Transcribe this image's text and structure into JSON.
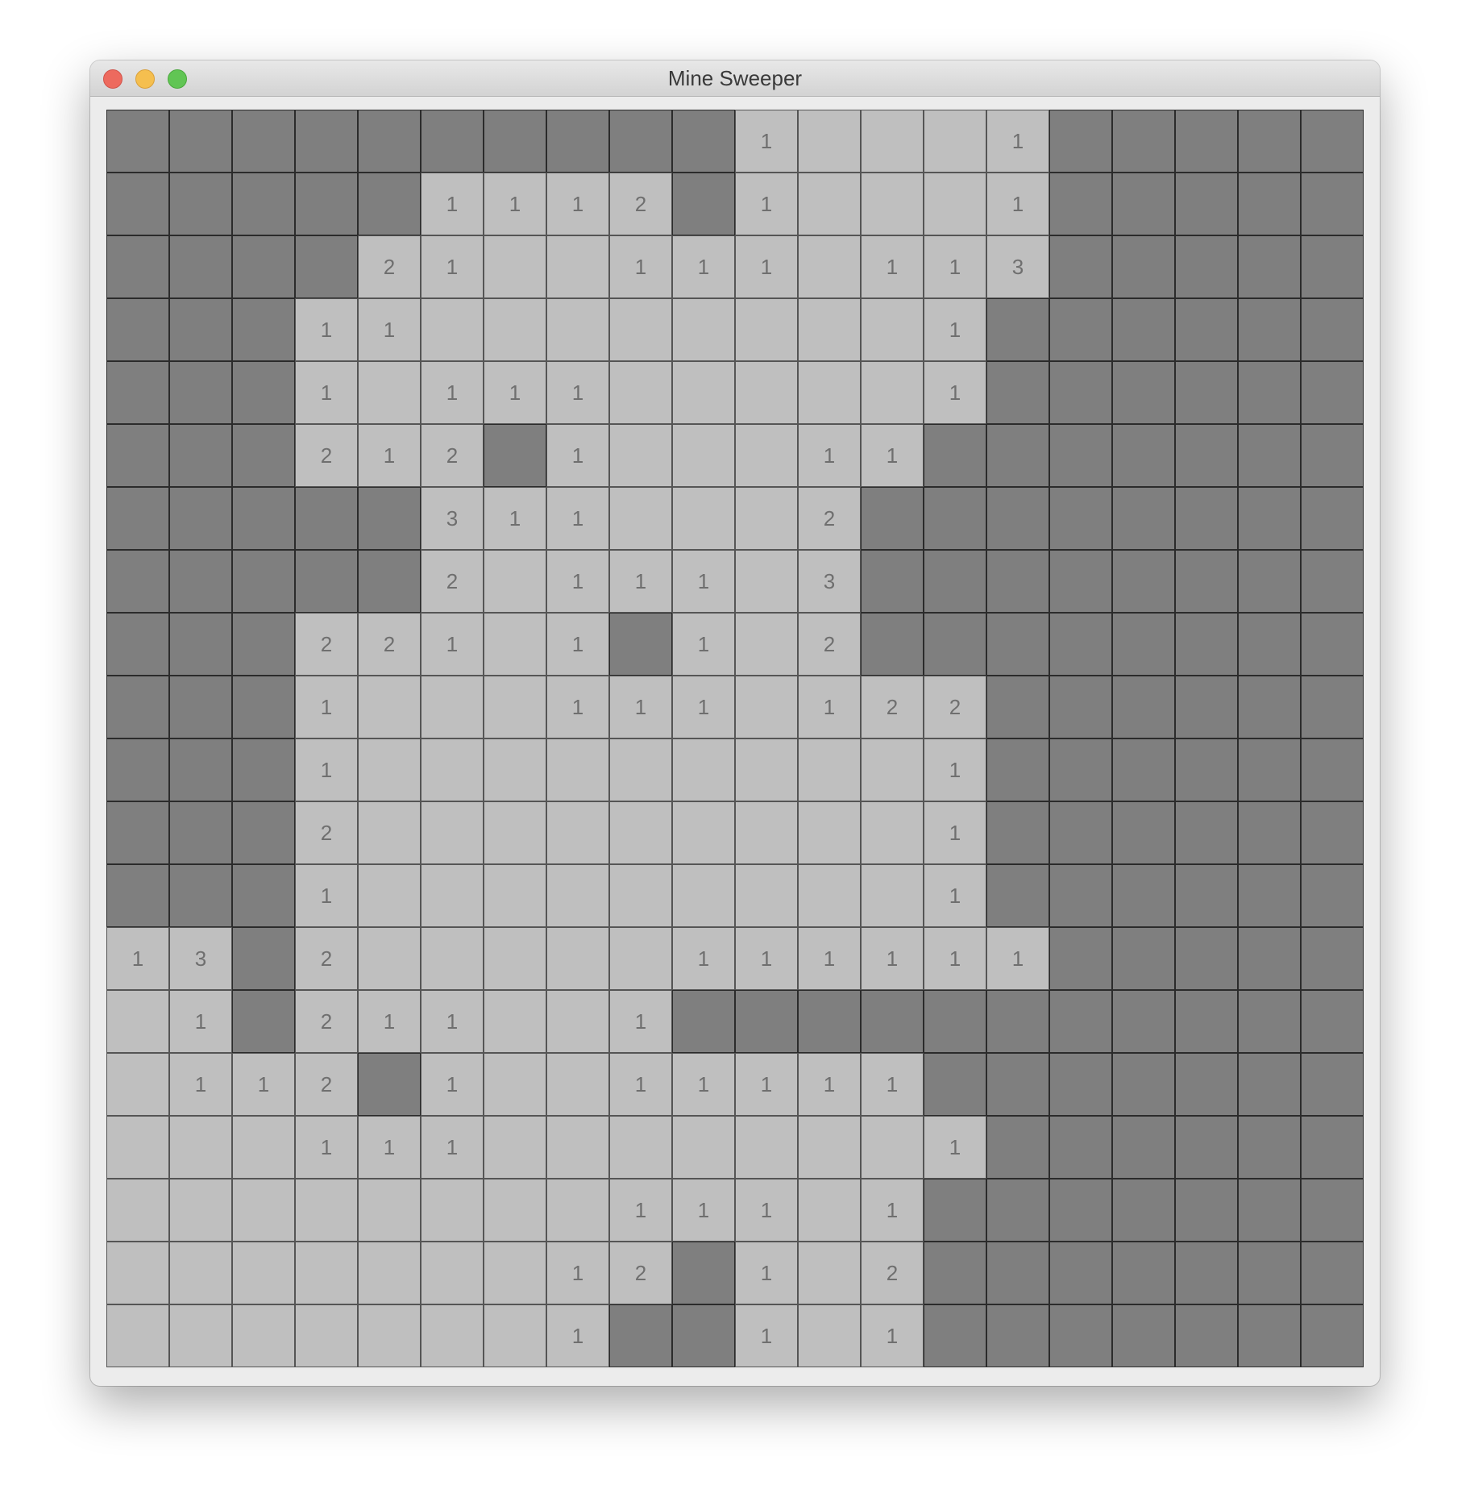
{
  "window": {
    "title": "Mine Sweeper"
  },
  "colors": {
    "hidden_cell": "#7f7f7f",
    "revealed_cell": "#bfbfbf",
    "number_text": "#6f6f6f",
    "close": "#ed6a5e",
    "minimize": "#f5bf4f",
    "maximize": "#61c554"
  },
  "board": {
    "rows": 20,
    "cols": 20,
    "legend": "'#' = unrevealed tile, '.' = revealed empty tile, digit = revealed tile showing adjacent mine count",
    "grid": [
      "##########1...1#####",
      "#####1112#1...1#####",
      "####21..111.113#####",
      "###11........1######",
      "###1.111.....1######",
      "###212#1...11#######",
      "#####311...2########",
      "#####2.111.3########",
      "###221.1#1.2########",
      "###1...111.122######",
      "###1.........1######",
      "###2.........1######",
      "###1.........1######",
      "13#2.....111111#####",
      ".1#211..1###########",
      ".112#1..11111#######",
      "...111.......1######",
      "........111.1#######",
      ".......12#1.2#######",
      ".......1##1.1#######"
    ]
  }
}
